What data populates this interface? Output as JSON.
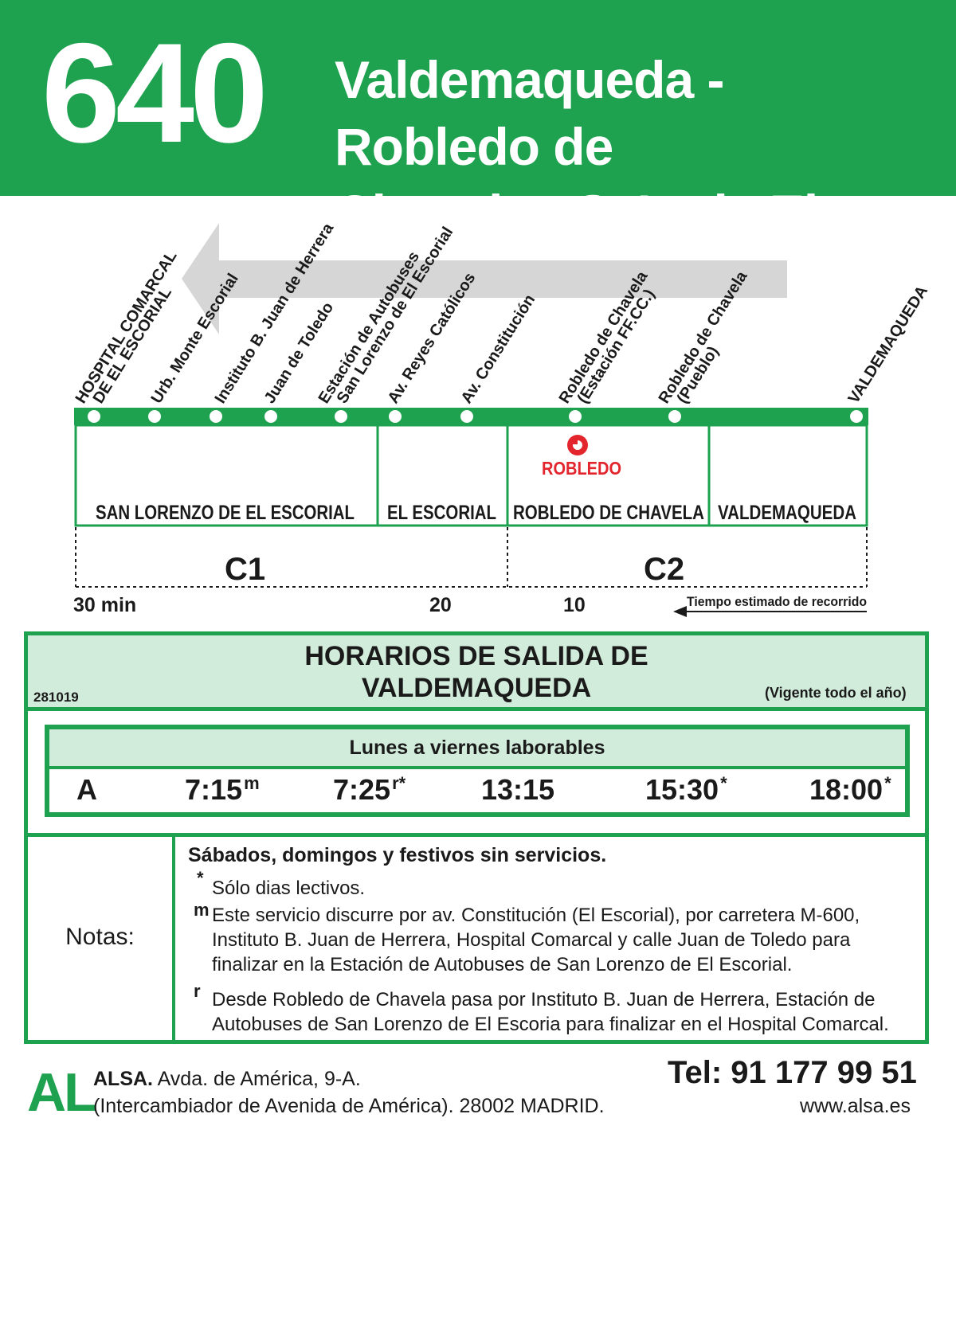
{
  "header": {
    "route_number": "640",
    "route_name_line1": "Valdemaqueda - Robledo de",
    "route_name_line2": "Chavela - S. L. de El Escorial"
  },
  "stops": [
    {
      "line1": "HOSPITAL COMARCAL",
      "line2": "DE EL ESCORIAL"
    },
    {
      "line1": "Urb. Monte Escorial"
    },
    {
      "line1": "Instituto B. Juan de Herrera"
    },
    {
      "line1": "Juan de Toledo"
    },
    {
      "line1": "Estación de Autobuses",
      "line2": "San Lorenzo de El Escorial"
    },
    {
      "line1": "Av. Reyes Católicos"
    },
    {
      "line1": "Av. Constitución"
    },
    {
      "line1": "Robledo de Chavela",
      "line2": "(Estación FF.CC.)"
    },
    {
      "line1": "Robledo de Chavela",
      "line2": "(Pueblo)"
    },
    {
      "line1": "VALDEMAQUEDA"
    }
  ],
  "zones": [
    "SAN LORENZO DE EL ESCORIAL",
    "EL ESCORIAL",
    "ROBLEDO DE CHAVELA",
    "VALDEMAQUEDA"
  ],
  "robledo_badge": "ROBLEDO",
  "fare_zones": [
    "C1",
    "C2"
  ],
  "travel_times": [
    "30 min",
    "20",
    "10"
  ],
  "travel_time_legend": "Tiempo estimado de recorrido",
  "schedule": {
    "title_line1": "HORARIOS DE SALIDA DE",
    "title_line2": "VALDEMAQUEDA",
    "code": "281019",
    "validity": "(Vigente todo el año)",
    "days_label": "Lunes a viernes laborables",
    "row_label": "A",
    "departures": [
      {
        "time": "7:15",
        "mark": "m"
      },
      {
        "time": "7:25",
        "mark": "r*"
      },
      {
        "time": "13:15",
        "mark": ""
      },
      {
        "time": "15:30",
        "mark": "*"
      },
      {
        "time": "18:00",
        "mark": "*"
      }
    ]
  },
  "notes": {
    "label": "Notas:",
    "headline": "Sábados, domingos y festivos sin servicios.",
    "items": [
      {
        "mark": "*",
        "lines": [
          "Sólo dias lectivos."
        ]
      },
      {
        "mark": "m",
        "lines": [
          "Este servicio discurre por av. Constitución (El Escorial), por carretera M-600,",
          "Instituto B. Juan de Herrera, Hospital Comarcal y calle Juan de Toledo para",
          "finalizar en la Estación de Autobuses de San Lorenzo de El Escorial."
        ]
      },
      {
        "mark": "r",
        "lines": [
          "Desde Robledo de Chavela pasa por Instituto B. Juan de Herrera, Estación de",
          "Autobuses de San Lorenzo de El Escoria para finalizar en el Hospital Comarcal."
        ]
      }
    ]
  },
  "footer": {
    "logo": "AL",
    "company": "ALSA.",
    "address_line1": "Avda. de América, 9-A.",
    "address_line2": "(Intercambiador de Avenida de América). 28002 MADRID.",
    "phone": "Tel: 91 177 99 51",
    "website": "www.alsa.es"
  },
  "colors": {
    "brand_green": "#1ea24f",
    "light_green": "#d2ecdb",
    "robledo_red": "#e3262d",
    "arrow_gray": "#d6d6d6"
  },
  "icons": [
    "direction-arrow-icon",
    "robledo-logo-icon",
    "al-logo",
    "legend-arrow-icon"
  ]
}
